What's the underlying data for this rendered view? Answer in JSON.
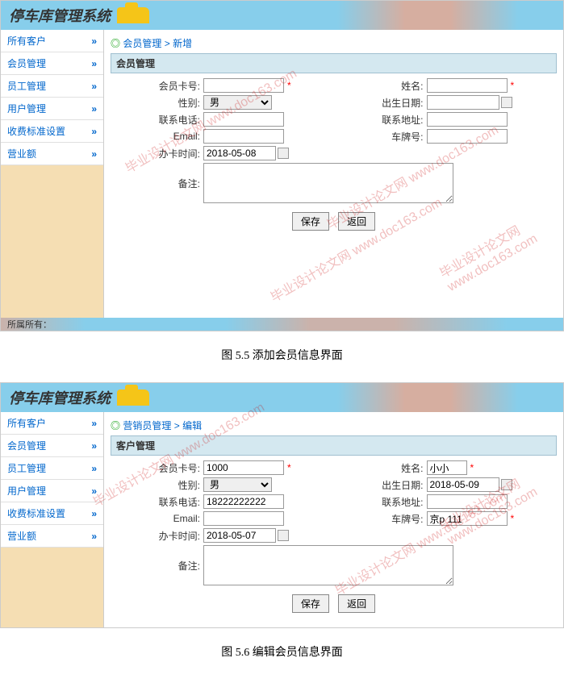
{
  "app_title": "停车库管理系统",
  "sidebar": {
    "items": [
      {
        "label": "所有客户"
      },
      {
        "label": "会员管理"
      },
      {
        "label": "员工管理"
      },
      {
        "label": "用户管理"
      },
      {
        "label": "收费标准设置"
      },
      {
        "label": "营业额"
      }
    ],
    "arrow": "»"
  },
  "screenshot1": {
    "breadcrumb": {
      "bullet": "◎",
      "part1": "会员管理",
      "sep": " > ",
      "part2": "新增"
    },
    "panel_title": "会员管理",
    "fields": {
      "card_no_label": "会员卡号:",
      "card_no_value": "",
      "name_label": "姓名:",
      "name_value": "",
      "gender_label": "性别:",
      "gender_value": "男",
      "birth_label": "出生日期:",
      "birth_value": "",
      "phone_label": "联系电话:",
      "phone_value": "",
      "addr_label": "联系地址:",
      "addr_value": "",
      "email_label": "Email:",
      "email_value": "",
      "plate_label": "车牌号:",
      "plate_value": "",
      "handle_date_label": "办卡时间:",
      "handle_date_value": "2018-05-08",
      "remark_label": "备注:",
      "remark_value": ""
    },
    "buttons": {
      "save": "保存",
      "back": "返回"
    },
    "footer": "所属所有："
  },
  "caption1": "图 5.5 添加会员信息界面",
  "screenshot2": {
    "breadcrumb": {
      "bullet": "◎",
      "part1": "营销员管理",
      "sep": " > ",
      "part2": "编辑"
    },
    "panel_title": "客户管理",
    "fields": {
      "card_no_label": "会员卡号:",
      "card_no_value": "1000",
      "name_label": "姓名:",
      "name_value": "小小",
      "gender_label": "性别:",
      "gender_value": "男",
      "birth_label": "出生日期:",
      "birth_value": "2018-05-09",
      "phone_label": "联系电话:",
      "phone_value": "18222222222",
      "addr_label": "联系地址:",
      "addr_value": "",
      "email_label": "Email:",
      "email_value": "",
      "plate_label": "车牌号:",
      "plate_value": "京p 111",
      "handle_date_label": "办卡时间:",
      "handle_date_value": "2018-05-07",
      "remark_label": "备注:",
      "remark_value": ""
    },
    "buttons": {
      "save": "保存",
      "back": "返回"
    }
  },
  "caption2": "图 5.6 编辑会员信息界面",
  "watermark_text": "毕业设计论文网\nwww.doc163.com",
  "star": "*"
}
